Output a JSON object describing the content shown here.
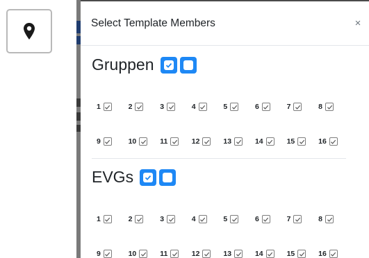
{
  "modal": {
    "title": "Select Template Members",
    "close_label": "×"
  },
  "icons": {
    "marker": "map-marker-icon",
    "close": "close-icon",
    "check": "check-icon"
  },
  "colors": {
    "accent": "#1e88f5",
    "backdrop": "#7a7a7a"
  },
  "groups": [
    {
      "title": "Gruppen",
      "rows": [
        [
          {
            "n": "1",
            "checked": true
          },
          {
            "n": "2",
            "checked": true
          },
          {
            "n": "3",
            "checked": true
          },
          {
            "n": "4",
            "checked": true
          },
          {
            "n": "5",
            "checked": true
          },
          {
            "n": "6",
            "checked": true
          },
          {
            "n": "7",
            "checked": true
          },
          {
            "n": "8",
            "checked": true
          }
        ],
        [
          {
            "n": "9",
            "checked": true
          },
          {
            "n": "10",
            "checked": true
          },
          {
            "n": "11",
            "checked": true
          },
          {
            "n": "12",
            "checked": true
          },
          {
            "n": "13",
            "checked": true
          },
          {
            "n": "14",
            "checked": true
          },
          {
            "n": "15",
            "checked": true
          },
          {
            "n": "16",
            "checked": true
          }
        ]
      ]
    },
    {
      "title": "EVGs",
      "rows": [
        [
          {
            "n": "1",
            "checked": true
          },
          {
            "n": "2",
            "checked": true
          },
          {
            "n": "3",
            "checked": true
          },
          {
            "n": "4",
            "checked": true
          },
          {
            "n": "5",
            "checked": true
          },
          {
            "n": "6",
            "checked": true
          },
          {
            "n": "7",
            "checked": true
          },
          {
            "n": "8",
            "checked": true
          }
        ],
        [
          {
            "n": "9",
            "checked": true
          },
          {
            "n": "10",
            "checked": true
          },
          {
            "n": "11",
            "checked": true
          },
          {
            "n": "12",
            "checked": true
          },
          {
            "n": "13",
            "checked": true
          },
          {
            "n": "14",
            "checked": true
          },
          {
            "n": "15",
            "checked": true
          },
          {
            "n": "16",
            "checked": true
          }
        ]
      ]
    }
  ]
}
